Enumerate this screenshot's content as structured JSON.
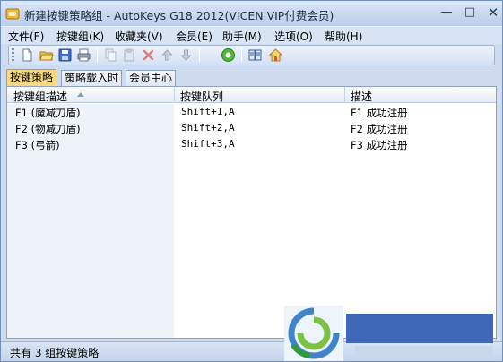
{
  "window": {
    "title": "新建按键策略组 - AutoKeys G18 2012(VICEN VIP付费会员)",
    "min_glyph": "—",
    "max_glyph": "□",
    "close_glyph": "✕"
  },
  "menu": [
    "文件(F)",
    "按键组(K)",
    "收藏夹(V)",
    "会员(E)",
    "助手(M)",
    "选项(O)",
    "帮助(H)"
  ],
  "toolbar": {
    "buttons": [
      "new-file-icon",
      "open-folder-icon",
      "save-icon",
      "print-icon",
      "copy-icon",
      "paste-icon",
      "delete-icon",
      "move-up-icon",
      "move-down-icon",
      "run-icon",
      "book-icon",
      "home-icon"
    ]
  },
  "tabs": [
    "按键策略",
    "策略载入时",
    "会员中心"
  ],
  "table": {
    "columns": [
      "按键组描述",
      "按键队列",
      "描述"
    ],
    "rows": [
      [
        "F1 (魔减刀盾)",
        "Shift+1,A",
        "F1 成功注册"
      ],
      [
        "F2 (物减刀盾)",
        "Shift+2,A",
        "F2 成功注册"
      ],
      [
        "F3 (弓箭)",
        "Shift+3,A",
        "F3 成功注册"
      ]
    ]
  },
  "status": "共有 3 组按键策略",
  "colors": {
    "active_tab": "#f8d982",
    "watermark_blue": "#3f68b8"
  }
}
